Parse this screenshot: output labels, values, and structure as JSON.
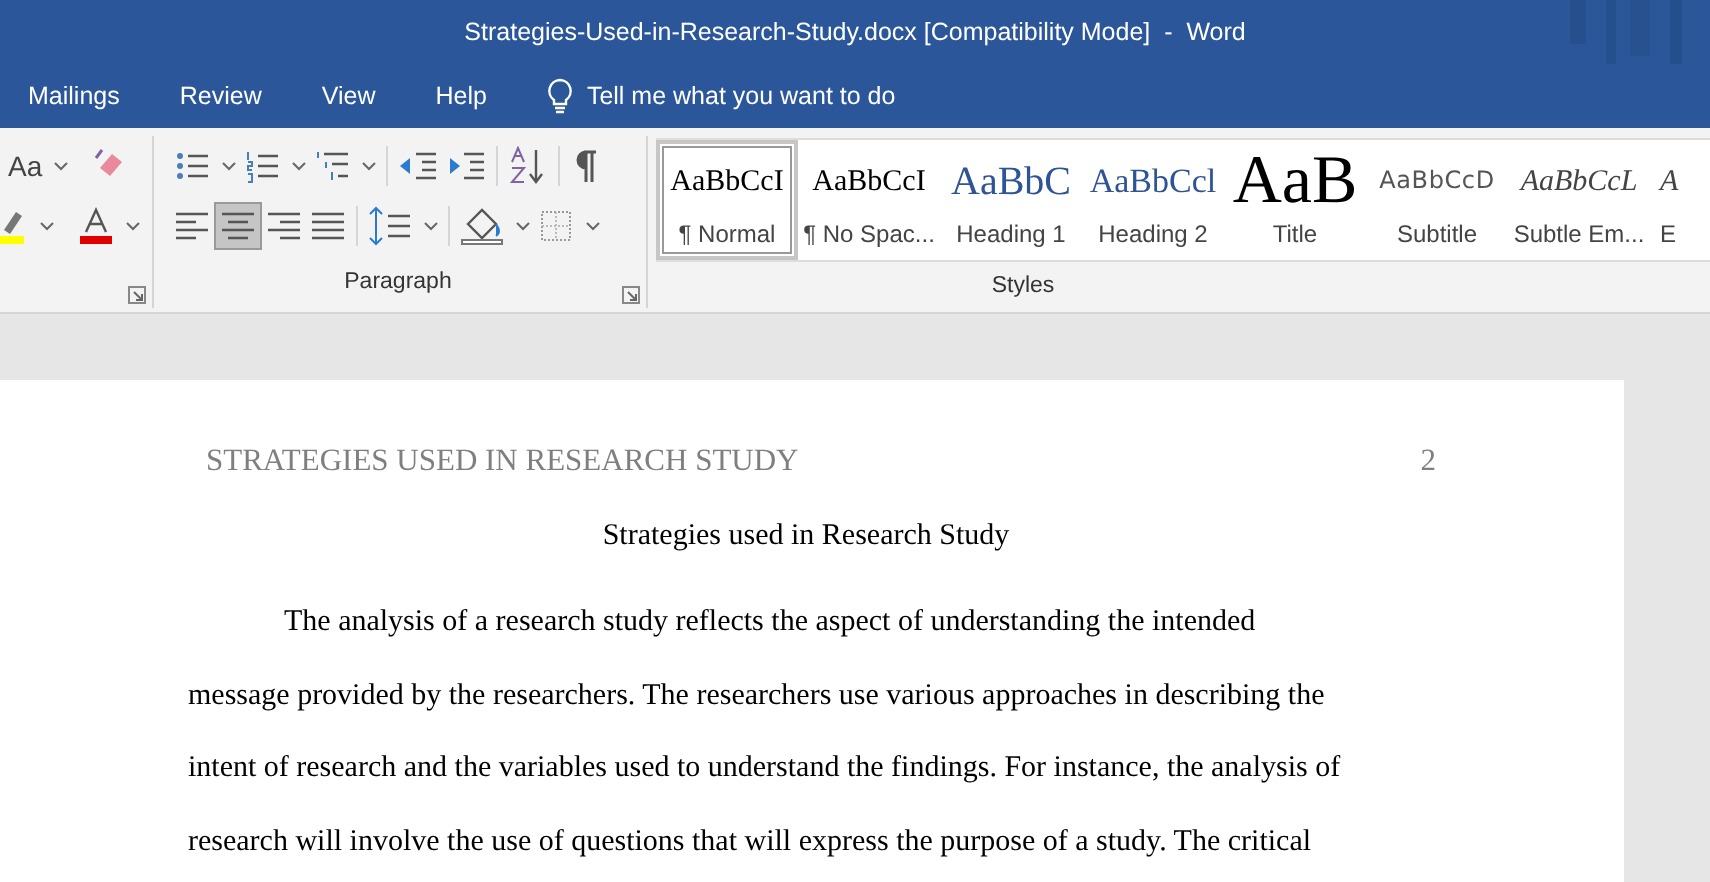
{
  "window": {
    "title": "Strategies-Used-in-Research-Study.docx [Compatibility Mode]  -  Word"
  },
  "ribbon_tabs": [
    {
      "label": "Mailings"
    },
    {
      "label": "Review"
    },
    {
      "label": "View"
    },
    {
      "label": "Help"
    }
  ],
  "tell_me": {
    "placeholder": "Tell me what you want to do"
  },
  "font_group": {
    "rows": [
      [
        {
          "kind": "case",
          "label": "Aa",
          "has_menu": true
        },
        {
          "kind": "clear",
          "has_menu": false
        }
      ],
      [
        {
          "kind": "highlight",
          "has_menu": true
        },
        {
          "kind": "fontcolor",
          "has_menu": true
        }
      ]
    ]
  },
  "paragraph_group": {
    "label": "Paragraph",
    "rows": [
      [
        {
          "kind": "bullets",
          "has_menu": true,
          "selected": false
        },
        {
          "kind": "numbering",
          "has_menu": true,
          "selected": false
        },
        {
          "kind": "multilevel",
          "has_menu": true,
          "selected": false
        },
        {
          "kind": "sep"
        },
        {
          "kind": "outdent",
          "has_menu": false,
          "selected": false
        },
        {
          "kind": "indent",
          "has_menu": false,
          "selected": false
        },
        {
          "kind": "sep"
        },
        {
          "kind": "sort",
          "has_menu": false,
          "selected": false
        },
        {
          "kind": "sep"
        },
        {
          "kind": "pilcrow",
          "has_menu": false,
          "selected": false
        }
      ],
      [
        {
          "kind": "left",
          "has_menu": false,
          "selected": false
        },
        {
          "kind": "center",
          "has_menu": false,
          "selected": true
        },
        {
          "kind": "right",
          "has_menu": false,
          "selected": false
        },
        {
          "kind": "justify",
          "has_menu": false,
          "selected": false
        },
        {
          "kind": "sep"
        },
        {
          "kind": "spacing",
          "has_menu": true,
          "selected": false
        },
        {
          "kind": "sep"
        },
        {
          "kind": "shading",
          "has_menu": true,
          "selected": false
        },
        {
          "kind": "borders",
          "has_menu": true,
          "selected": false
        }
      ]
    ]
  },
  "styles_group": {
    "label": "Styles",
    "styles": [
      {
        "preview": "AaBbCcI",
        "label": "¶ Normal",
        "kind": "normal",
        "selected": true
      },
      {
        "preview": "AaBbCcI",
        "label": "¶ No Spac...",
        "kind": "normal",
        "selected": false
      },
      {
        "preview": "AaBbC",
        "label": "Heading 1",
        "kind": "heading1",
        "selected": false
      },
      {
        "preview": "AaBbCcl",
        "label": "Heading 2",
        "kind": "heading2",
        "selected": false
      },
      {
        "preview": "AaB",
        "label": "Title",
        "kind": "title",
        "selected": false
      },
      {
        "preview": "AaBbCcD",
        "label": "Subtitle",
        "kind": "subtitle",
        "selected": false
      },
      {
        "preview": "AaBbCcL",
        "label": "Subtle Em...",
        "kind": "emphasis",
        "selected": false
      },
      {
        "preview": "A",
        "label": "E",
        "kind": "emphasis",
        "selected": false
      }
    ]
  },
  "document": {
    "header": "STRATEGIES USED IN RESEARCH STUDY",
    "page_number": "2",
    "title": "Strategies used in Research Study",
    "lines": [
      "The analysis of a research study reflects the aspect of understanding the intended",
      "message provided by the researchers. The researchers use various approaches in describing the",
      "intent of research and the variables used to understand the findings. For instance, the analysis of",
      "research will involve the use of questions that will express the purpose of a study. The critical"
    ]
  }
}
